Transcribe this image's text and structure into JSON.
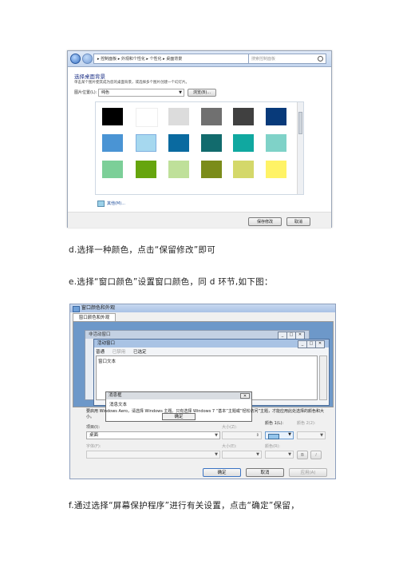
{
  "screenshot1": {
    "address": [
      "控制面板",
      "外观和个性化",
      "个性化",
      "桌面背景"
    ],
    "search_placeholder": "搜索控制面板",
    "heading": "选择桌面背景",
    "subtitle": "单击某个图片使其成为您的桌面背景，或选择多个图片创建一个幻灯片。",
    "location_label": "图片位置(L):",
    "location_value": "纯色",
    "browse_label": "浏览(B)...",
    "swatches": [
      "#000000",
      "#ffffff",
      "#dcdcdc",
      "#707070",
      "#404040",
      "#083a7a",
      "#4a94d4",
      "#a6d8ef",
      "#0a6aa0",
      "#126b6d",
      "#10a8a0",
      "#7fd2c8",
      "#7ccf98",
      "#66a50e",
      "#bfe09a",
      "#7b8c1a",
      "#d4d86a",
      "#fff366"
    ],
    "selected_swatch": 7,
    "more_label": "其他(M)...",
    "save_label": "保存修改",
    "cancel_label": "取消"
  },
  "caption_d": "d.选择一种颜色，点击“保留修改”即可",
  "caption_e": "e.选择“窗口颜色”设置窗口颜色，同 d 环节,如下图：",
  "screenshot2": {
    "title": "窗口颜色和外观",
    "tab": "窗口颜色和外观",
    "inactive_title": "非活动窗口",
    "active_title": "活动窗口",
    "menu": [
      "普通",
      "已禁用",
      "已选定"
    ],
    "window_text": "窗口文本",
    "msgbox_title": "消息框",
    "msgbox_text": "消息文本",
    "ok_label": "确定",
    "info": "要启用 Windows Aero，请选择 Windows 主题。只有选择 Windows 7 “基本”主题或“轻松访问”主题，才能应用此处选择的颜色和大小。",
    "item_label": "项目(I):",
    "item_value": "桌面",
    "size_label": "大小(Z):",
    "color1_label": "颜色 1(L):",
    "color2_label": "颜色 2(2):",
    "font_label": "字体(F):",
    "size2_label": "大小(E):",
    "color_label": "颜色(R):",
    "bold_label": "B",
    "italic_label": "I",
    "confirm_label": "确定",
    "cancel_label": "取消",
    "apply_label": "应用(A)"
  },
  "caption_f": "f.通过选择“屏幕保护程序”进行有关设置，点击“确定”保留，"
}
